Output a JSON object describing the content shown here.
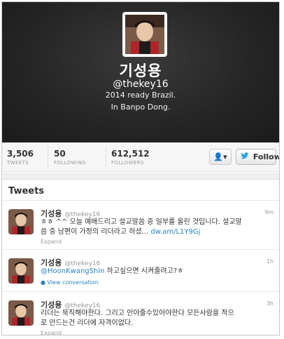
{
  "profile": {
    "name": "기성용",
    "handle": "@thekey16",
    "bio": "2014 ready Brazil.",
    "location": "In Banpo Dong."
  },
  "stats": [
    {
      "value": "3,506",
      "label": "TWEETS"
    },
    {
      "value": "50",
      "label": "FOLLOWING"
    },
    {
      "value": "612,512",
      "label": "FOLLOWERS"
    }
  ],
  "actions": {
    "user_menu_icon": "👤▾",
    "follow_label": "Follow",
    "follow_icon": "twitter-bird-icon"
  },
  "tweets_heading": "Tweets",
  "tweets": [
    {
      "name": "기성용",
      "handle": "@thekey16",
      "time": "9m",
      "text_line1": "ㅎㅎ ^^ 오늘 예배드리고 설교말씀 중 일부를 올린 것입니다. 설교말",
      "text_line2_prefix": "씀 중 남편이 가정의 리더라고 하셨... ",
      "link": "dw.am/L1Y9Gj",
      "footer": "Expand"
    },
    {
      "name": "기성용",
      "handle": "@thekey16",
      "time": "1h",
      "mention": "@HoonKwangShin",
      "text_after_mention": " 하고싶으면 시켜줄려고?ㅎ",
      "footer": "View conversation"
    },
    {
      "name": "기성용",
      "handle": "@thekey16",
      "time": "3h",
      "text_line1": "리더는 묵직해야한다. 그리고 안아줄수있어야한다 모든사람을 적으",
      "text_line2": "로 만드는건 리더에 자격이없다.",
      "footer": "Expand"
    }
  ],
  "colors": {
    "header_bg": "#262626",
    "link": "#2a83c2",
    "bird": "#2aa9e0"
  }
}
